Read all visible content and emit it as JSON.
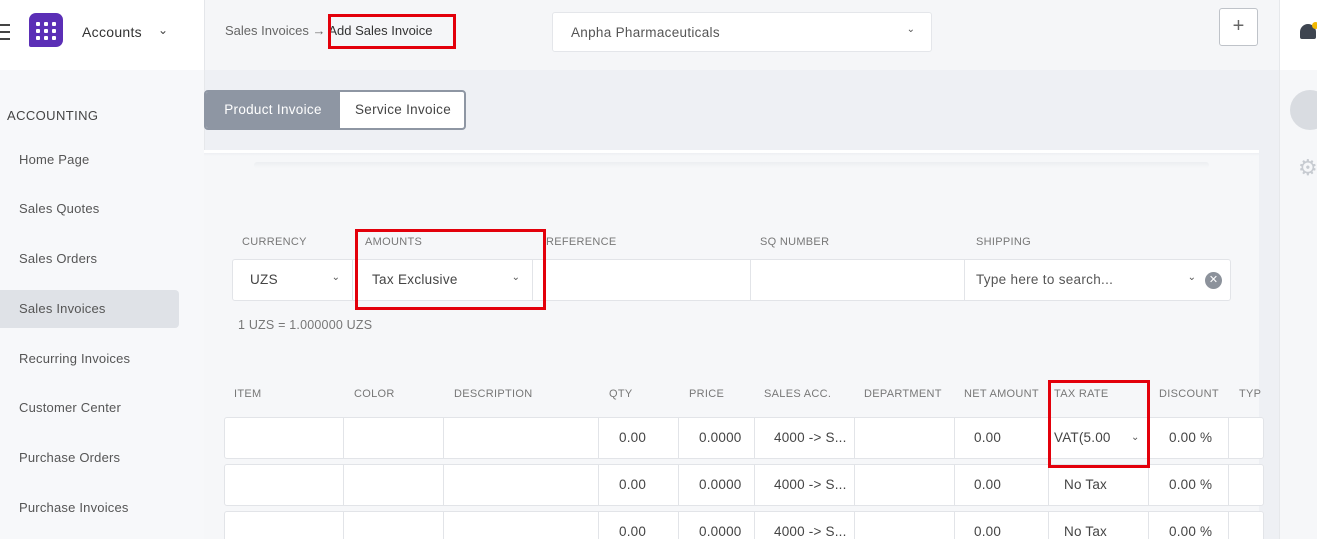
{
  "app": {
    "name": "Accounts"
  },
  "breadcrumb": {
    "parent": "Sales Invoices",
    "separator": "→",
    "current": "Add Sales Invoice"
  },
  "company": {
    "selected": "Anpha Pharmaceuticals"
  },
  "toolbar": {
    "add_label": "+"
  },
  "sidebar": {
    "section": "ACCOUNTING",
    "items": [
      {
        "label": "Home Page"
      },
      {
        "label": "Sales Quotes"
      },
      {
        "label": "Sales Orders"
      },
      {
        "label": "Sales Invoices"
      },
      {
        "label": "Recurring Invoices"
      },
      {
        "label": "Customer Center"
      },
      {
        "label": "Purchase Orders"
      },
      {
        "label": "Purchase Invoices"
      }
    ],
    "active": "Sales Invoices"
  },
  "tabs": {
    "product": "Product Invoice",
    "service": "Service Invoice"
  },
  "form": {
    "currency_label": "CURRENCY",
    "currency_value": "UZS",
    "amounts_label": "AMOUNTS",
    "amounts_value": "Tax Exclusive",
    "reference_label": "REFERENCE",
    "sq_label": "SQ NUMBER",
    "shipping_label": "SHIPPING",
    "shipping_placeholder": "Type here to search...",
    "exchange_note": "1 UZS = 1.000000 UZS"
  },
  "items": {
    "headers": [
      "ITEM",
      "COLOR",
      "DESCRIPTION",
      "QTY",
      "PRICE",
      "SALES ACC.",
      "DEPARTMENT",
      "NET AMOUNT",
      "TAX RATE",
      "DISCOUNT",
      "TYP"
    ],
    "rows": [
      {
        "qty": "0.00",
        "price": "0.0000",
        "account": "4000 -> S...",
        "net": "0.00",
        "tax": "VAT(5.00",
        "discount": "0.00 %"
      },
      {
        "qty": "0.00",
        "price": "0.0000",
        "account": "4000 -> S...",
        "net": "0.00",
        "tax": "No Tax",
        "discount": "0.00 %"
      },
      {
        "qty": "0.00",
        "price": "0.0000",
        "account": "4000 -> S...",
        "net": "0.00",
        "tax": "No Tax",
        "discount": "0.00 %"
      }
    ]
  },
  "colors": {
    "accent": "#5b2fb6",
    "tab_active": "#8e96a3",
    "highlight": "#e3000b",
    "notification": "#f2b800"
  }
}
